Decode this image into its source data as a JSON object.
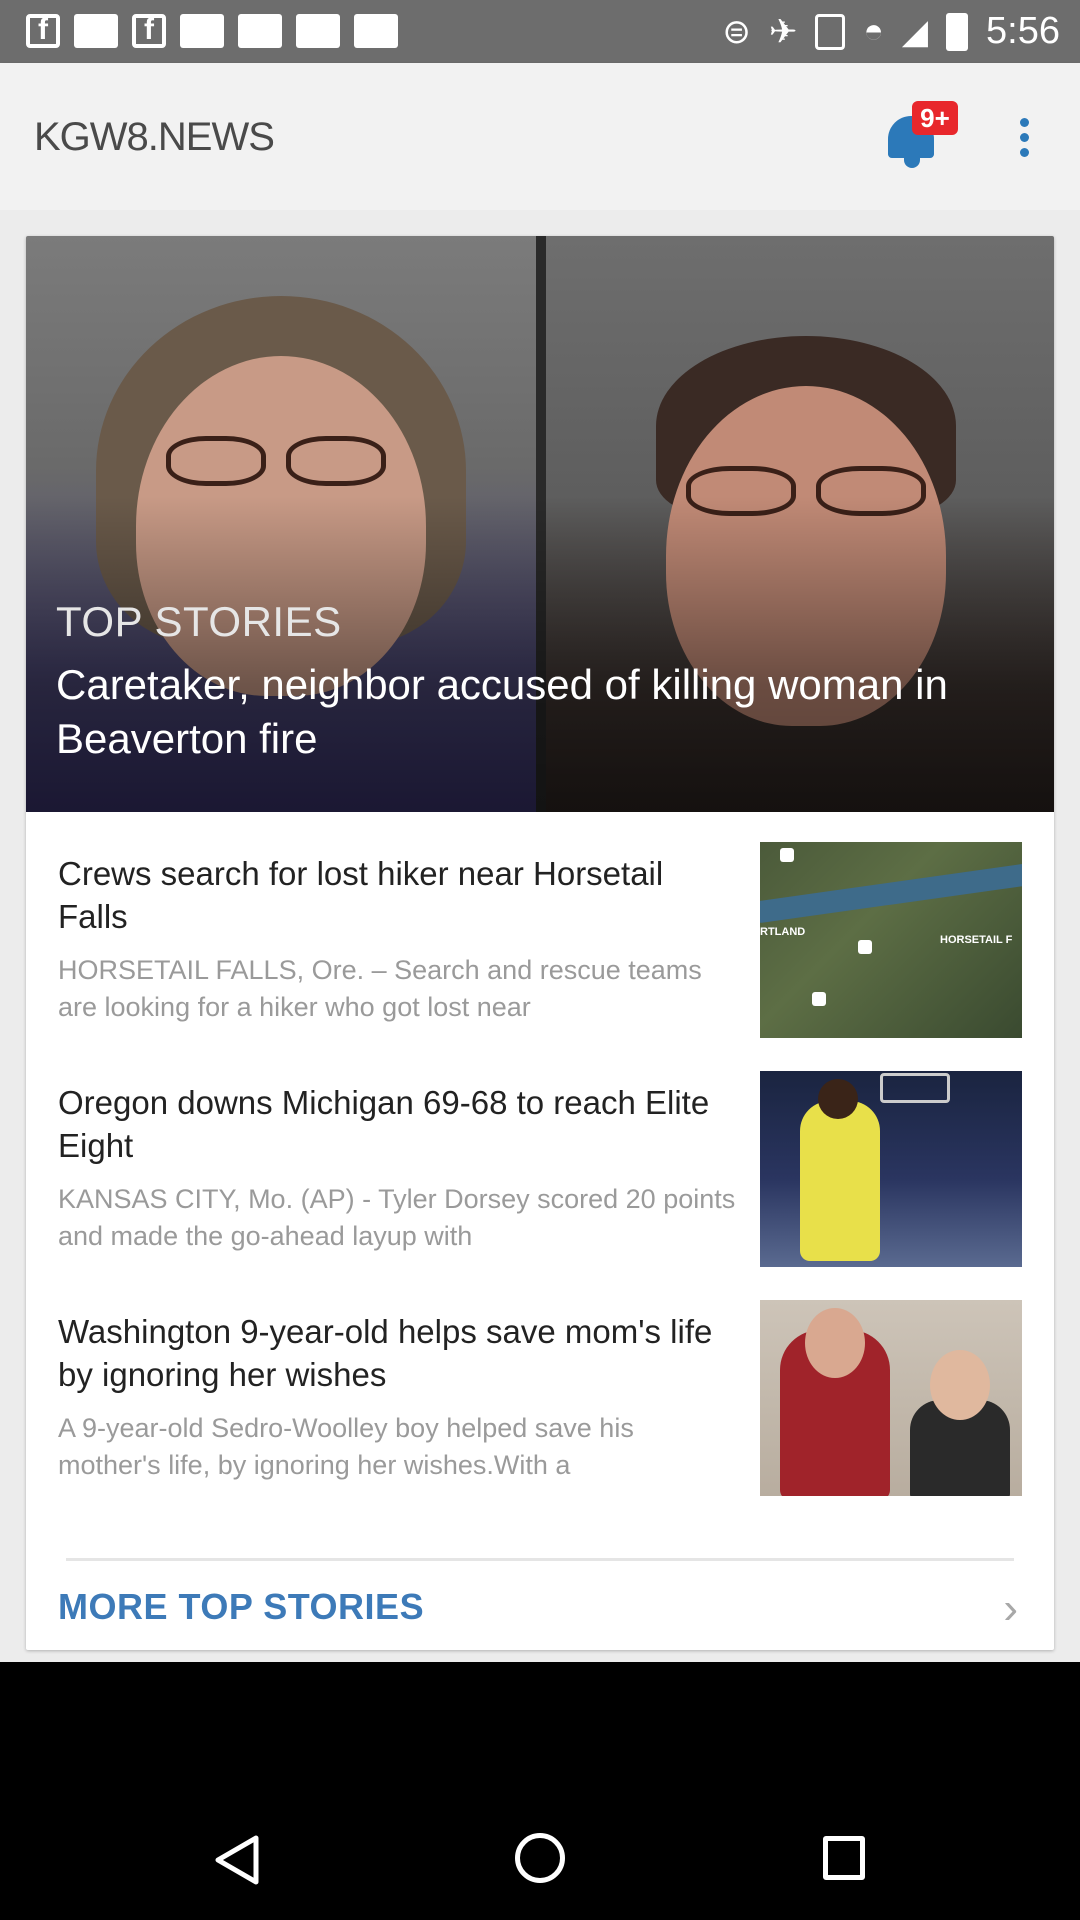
{
  "status_bar": {
    "time": "5:56"
  },
  "app_bar": {
    "logo_text": "KGW8.NEWS",
    "notification_badge": "9+",
    "accent_color": "#2c79b9",
    "badge_color": "#e8272c"
  },
  "hero": {
    "kicker": "TOP STORIES",
    "title": "Caretaker, neighbor accused of killing woman in Beaverton fire"
  },
  "stories": [
    {
      "title": "Crews search for lost hiker near Horsetail Falls",
      "summary": "HORSETAIL FALLS, Ore. – Search and rescue teams are looking for a hiker who got lost near",
      "thumb_labels": [
        "RTLAND",
        "HORSETAIL F"
      ]
    },
    {
      "title": "Oregon downs Michigan 69-68 to reach Elite Eight",
      "summary": "KANSAS CITY, Mo. (AP) - Tyler Dorsey scored 20 points and made the go-ahead layup with"
    },
    {
      "title": "Washington 9-year-old helps save mom's life by ignoring her wishes",
      "summary": "A 9-year-old Sedro-Woolley boy helped save his mother's life, by ignoring her wishes.With a"
    }
  ],
  "more": {
    "label": "MORE TOP STORIES",
    "color": "#3d7ab8"
  },
  "icons": {
    "notifications": "bell-icon",
    "overflow": "more-vert-icon",
    "more_chevron": "chevron-right-icon",
    "nav_back": "back-triangle-icon",
    "nav_home": "home-circle-icon",
    "nav_recents": "recents-square-icon"
  }
}
